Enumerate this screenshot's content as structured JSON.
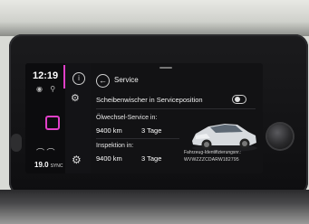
{
  "status": {
    "time": "12:19"
  },
  "climate": {
    "temperature": "19.0",
    "sync_label": "SYNC"
  },
  "header": {
    "title": "Service"
  },
  "wiper": {
    "label": "Scheibenwischer in Serviceposition",
    "enabled": false
  },
  "oil_service": {
    "label": "Ölwechsel-Service in:",
    "distance": "9400 km",
    "time": "3 Tage"
  },
  "inspection": {
    "label": "Inspektion in:",
    "distance": "9400 km",
    "time": "3 Tage"
  },
  "vehicle": {
    "vin_label": "Fahrzeug-Identifizierungsnr.:",
    "vin": "WVWZZZCDARW182795"
  },
  "icons": {
    "back": "back-arrow-icon",
    "info": "info-icon",
    "service": "service-icon",
    "settings": "gear-icon",
    "home": "home-square-icon",
    "seat": "seat-heater-icon",
    "car": "car-image"
  },
  "colors": {
    "accent": "#e040c8",
    "screen_bg": "#121214"
  }
}
